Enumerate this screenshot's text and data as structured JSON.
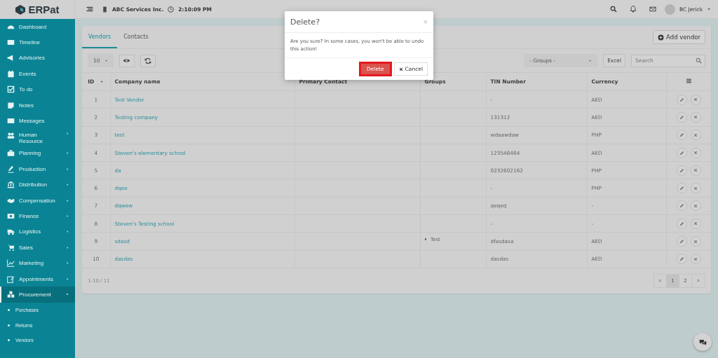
{
  "logo": {
    "text": "ERPat"
  },
  "topbar": {
    "company": "ABC Services Inc.",
    "time": "2:10:09 PM",
    "user": "BC Jerick"
  },
  "sidebar": {
    "items": [
      {
        "label": "Dashboard",
        "kind": "link",
        "selected": false
      },
      {
        "label": "Timeline",
        "kind": "link",
        "selected": false
      },
      {
        "label": "Advisories",
        "kind": "link",
        "selected": false
      },
      {
        "label": "Events",
        "kind": "link",
        "selected": false
      },
      {
        "label": "To do",
        "kind": "link",
        "selected": false
      },
      {
        "label": "Notes",
        "kind": "link",
        "selected": false
      },
      {
        "label": "Messages",
        "kind": "link",
        "selected": false
      },
      {
        "label": "Human Resource",
        "kind": "group",
        "selected": false,
        "expanded": false
      },
      {
        "label": "Planning",
        "kind": "group",
        "selected": false,
        "expanded": false
      },
      {
        "label": "Production",
        "kind": "group",
        "selected": false,
        "expanded": false
      },
      {
        "label": "Distribution",
        "kind": "group",
        "selected": false,
        "expanded": false
      },
      {
        "label": "Compensation",
        "kind": "group",
        "selected": false,
        "expanded": false
      },
      {
        "label": "Finance",
        "kind": "group",
        "selected": false,
        "expanded": false
      },
      {
        "label": "Logistics",
        "kind": "group",
        "selected": false,
        "expanded": false
      },
      {
        "label": "Sales",
        "kind": "group",
        "selected": false,
        "expanded": false
      },
      {
        "label": "Marketing",
        "kind": "group",
        "selected": false,
        "expanded": false
      },
      {
        "label": "Appointments",
        "kind": "group",
        "selected": false,
        "expanded": false
      },
      {
        "label": "Procurement",
        "kind": "group",
        "selected": true,
        "expanded": true,
        "children": [
          {
            "label": "Purchases",
            "selected": false
          },
          {
            "label": "Returns",
            "selected": false
          },
          {
            "label": "Vendors",
            "selected": false
          }
        ]
      }
    ]
  },
  "tabs": [
    {
      "label": "Vendors",
      "selected": true
    },
    {
      "label": "Contacts",
      "selected": false
    }
  ],
  "add_button": "Add vendor",
  "toolbar": {
    "page_size": "10",
    "groups_filter": "- Groups -",
    "excel": "Excel",
    "search_placeholder": "Search"
  },
  "table": {
    "columns": [
      "ID",
      "Company name",
      "Primary Contact",
      "Groups",
      "TIN Number",
      "Currency"
    ],
    "rows": [
      {
        "id": "1",
        "company": "Test Vendor",
        "groups": [],
        "tin": "-",
        "currency": "AED"
      },
      {
        "id": "2",
        "company": "Testing company",
        "groups": [],
        "tin": "131312",
        "currency": "AED"
      },
      {
        "id": "3",
        "company": "test",
        "groups": [],
        "tin": "wdaawdaw",
        "currency": "PHP"
      },
      {
        "id": "4",
        "company": "Steven's elementary school",
        "groups": [],
        "tin": "123546464",
        "currency": "AED"
      },
      {
        "id": "5",
        "company": "da",
        "groups": [],
        "tin": "0232602162",
        "currency": "PHP"
      },
      {
        "id": "6",
        "company": "dqee",
        "groups": [],
        "tin": "-",
        "currency": "PHP"
      },
      {
        "id": "7",
        "company": "dqwew",
        "groups": [],
        "tin": "qeqeq",
        "currency": "-"
      },
      {
        "id": "8",
        "company": "Steven's Testing school",
        "groups": [],
        "tin": "-",
        "currency": "-"
      },
      {
        "id": "9",
        "company": "sdasd",
        "groups": [
          "Test"
        ],
        "tin": "dfasdasa",
        "currency": "AED"
      },
      {
        "id": "10",
        "company": "dasdas",
        "groups": [],
        "tin": "dasdas",
        "currency": "AED"
      }
    ]
  },
  "footer": {
    "summary": "1-10 / 11",
    "pages": [
      {
        "label": "«",
        "kind": "prev",
        "selected": false
      },
      {
        "label": "1",
        "kind": "page",
        "selected": true
      },
      {
        "label": "2",
        "kind": "page",
        "selected": false
      },
      {
        "label": "»",
        "kind": "next",
        "selected": false
      }
    ]
  },
  "modal": {
    "title": "Delete?",
    "close": "×",
    "message": "Are you sure? In some cases, you won't be able to undo this action!",
    "confirm": "Delete",
    "cancel": "Cancel"
  }
}
